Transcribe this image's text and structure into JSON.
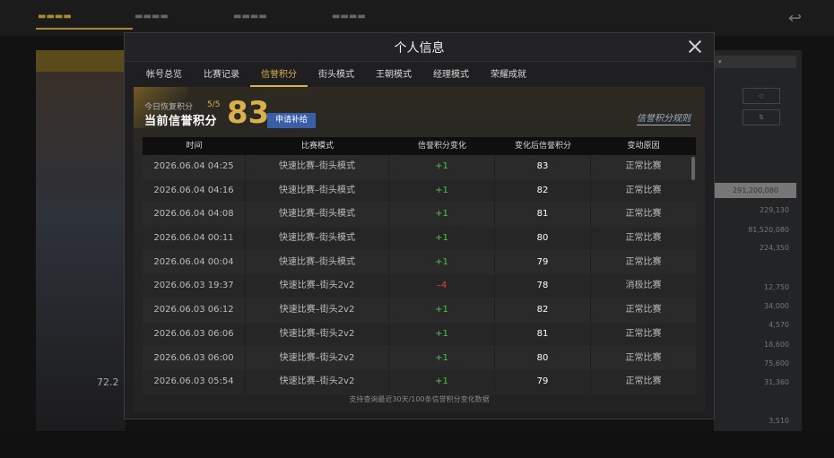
{
  "modal": {
    "title": "个人信息",
    "tabs": [
      "帐号总览",
      "比赛记录",
      "信誉积分",
      "街头模式",
      "王朝模式",
      "经理模式",
      "荣耀成就"
    ],
    "active_tab_index": 2
  },
  "credit": {
    "today_label": "今日恢复积分",
    "today_value": "5/5",
    "current_label": "当前信誉积分",
    "current_value": "83",
    "apply_button": "申请补给",
    "rules_link": "信誉积分规则"
  },
  "table": {
    "headers": [
      "时间",
      "比赛模式",
      "信誉积分变化",
      "变化后信誉积分",
      "变动原因"
    ],
    "rows": [
      {
        "time": "2026.06.04  04:25",
        "mode": "快速比赛–街头模式",
        "change": "+1",
        "after": "83",
        "reason": "正常比赛"
      },
      {
        "time": "2026.06.04  04:16",
        "mode": "快速比赛–街头模式",
        "change": "+1",
        "after": "82",
        "reason": "正常比赛"
      },
      {
        "time": "2026.06.04  04:08",
        "mode": "快速比赛–街头模式",
        "change": "+1",
        "after": "81",
        "reason": "正常比赛"
      },
      {
        "time": "2026.06.04  00:11",
        "mode": "快速比赛–街头模式",
        "change": "+1",
        "after": "80",
        "reason": "正常比赛"
      },
      {
        "time": "2026.06.04  00:04",
        "mode": "快速比赛–街头模式",
        "change": "+1",
        "after": "79",
        "reason": "正常比赛"
      },
      {
        "time": "2026.06.03  19:37",
        "mode": "快速比赛–街头2v2",
        "change": "–4",
        "after": "78",
        "reason": "消极比赛"
      },
      {
        "time": "2026.06.03  06:12",
        "mode": "快速比赛–街头2v2",
        "change": "+1",
        "after": "82",
        "reason": "正常比赛"
      },
      {
        "time": "2026.06.03  06:06",
        "mode": "快速比赛–街头2v2",
        "change": "+1",
        "after": "81",
        "reason": "正常比赛"
      },
      {
        "time": "2026.06.03  06:00",
        "mode": "快速比赛–街头2v2",
        "change": "+1",
        "after": "80",
        "reason": "正常比赛"
      },
      {
        "time": "2026.06.03  05:54",
        "mode": "快速比赛–街头2v2",
        "change": "+1",
        "after": "79",
        "reason": "正常比赛"
      }
    ],
    "footer_note": "支持查询最近30天/100条信誉积分变化数据"
  },
  "background": {
    "left_number": "72.2",
    "right_highlight": "291,200,080",
    "right_values": [
      "229,130",
      "81,520,080",
      "224,350",
      "12,750",
      "34,000",
      "4,570",
      "18,600",
      "75,600",
      "31,360",
      "3,510"
    ]
  },
  "colors": {
    "accent_gold": "#d9b04a",
    "positive": "#4fc24f",
    "negative": "#e24848",
    "apply_button": "#3a5ea8"
  }
}
